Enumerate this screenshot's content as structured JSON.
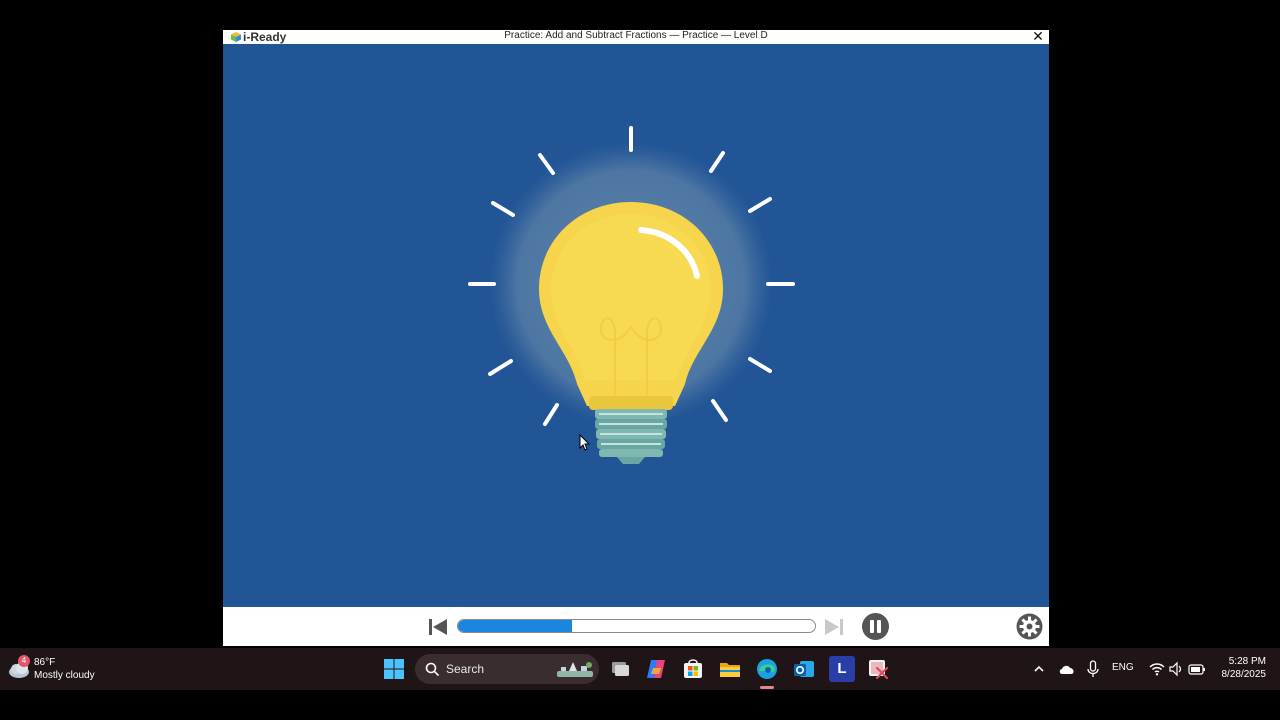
{
  "window": {
    "logo_text": "i-Ready",
    "title": "Practice: Add and Subtract Fractions — Practice — Level D",
    "close_glyph": "✕"
  },
  "stage": {
    "background_color": "#225596",
    "illustration": "lightbulb-icon"
  },
  "player": {
    "progress_fraction": 0.32,
    "progress_color": "#1a86e0",
    "controls": [
      "skip-back-icon",
      "skip-forward-icon",
      "pause-icon",
      "gear-icon"
    ]
  },
  "taskbar": {
    "weather": {
      "badge": "4",
      "temperature": "86°F",
      "description": "Mostly cloudy"
    },
    "search_label": "Search",
    "apps": [
      "windows-start-icon",
      "task-view-icon",
      "copilot-icon",
      "microsoft-store-icon",
      "file-explorer-icon",
      "edge-icon",
      "outlook-icon",
      "l-app-icon",
      "snipping-tool-icon"
    ],
    "l_app_letter": "L",
    "language": "ENG",
    "time": "5:28 PM",
    "date": "8/28/2025"
  }
}
